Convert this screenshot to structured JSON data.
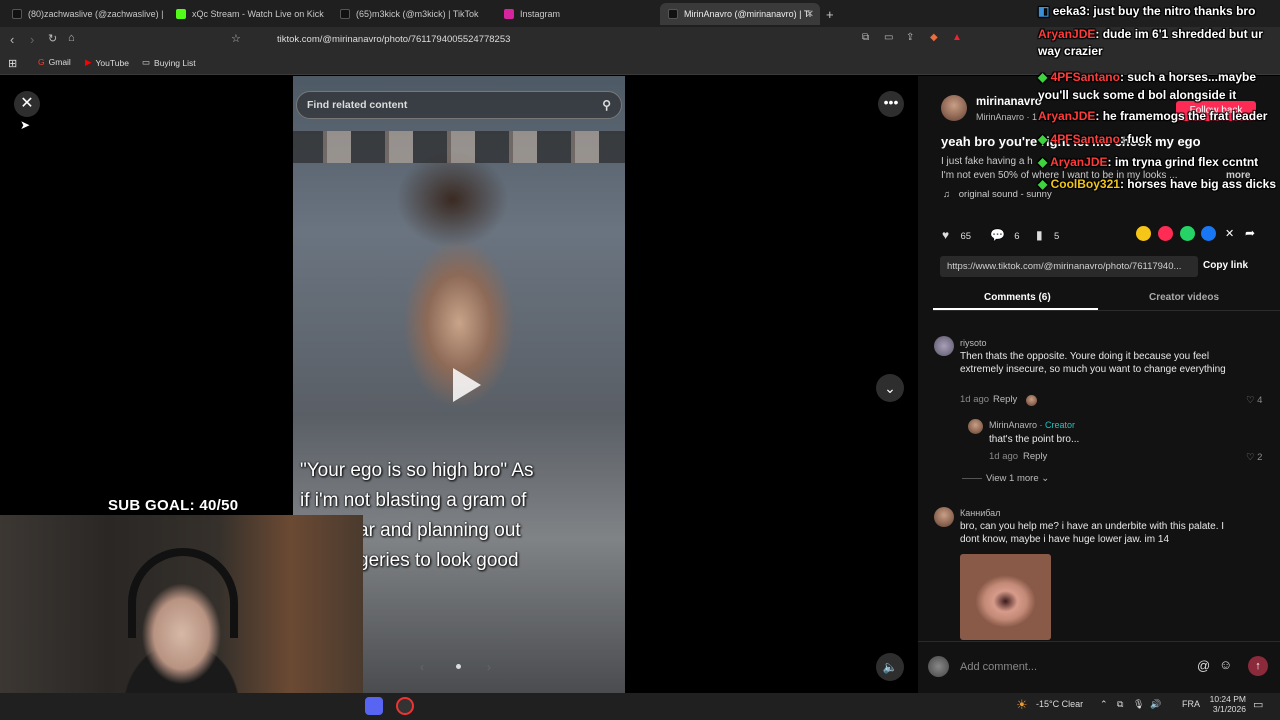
{
  "browser": {
    "tabs": [
      {
        "title": "(80)zachwaslive (@zachwaslive) | TikT",
        "color": "#111111"
      },
      {
        "title": "xQc Stream - Watch Live on Kick",
        "color": "#53fc18"
      },
      {
        "title": "(65)m3kick (@m3kick) | TikTok",
        "color": "#111111"
      },
      {
        "title": "Instagram",
        "color": "#d6249f"
      },
      {
        "title": "MirinAnavro (@mirinanavro) | Ti",
        "color": "#111111"
      }
    ],
    "url": "tiktok.com/@mirinanavro/photo/7611794005524778253",
    "bookmarks": [
      "Gmail",
      "YouTube",
      "Buying List"
    ]
  },
  "viewer": {
    "search_placeholder": "Find related content",
    "caption_lines": [
      "\"Your ego is so high bro\" As",
      "if i'm not blasting a gram of",
      "ar and planning out",
      "geries to look good"
    ]
  },
  "stream_overlay": {
    "sub_goal": "SUB GOAL: 40/50",
    "chat": [
      {
        "user": "eeka3",
        "text": ": just buy the nitro thanks bro",
        "color": "#ffffff"
      },
      {
        "user": "AryanJDE",
        "text": ": dude im 6'1 shredded but ur way crazier",
        "color": "#ff3b3b"
      },
      {
        "user": "4PFSantano",
        "text": ": such a horses...maybe you'll suck some d bol alongside it",
        "color": "#ff3b3b"
      },
      {
        "user": "AryanJDE",
        "text": ": he framemogs the frat leader",
        "color": "#ff3b3b"
      },
      {
        "user": "4PFSantano",
        "text": ": fuck",
        "color": "#ff3b3b"
      },
      {
        "user": "AryanJDE",
        "text": ": im tryna grind flex ccntnt",
        "color": "#ff3b3b"
      },
      {
        "user": "CoolBoy321",
        "text": ": horses have big ass dicks",
        "color": "#f0c419"
      }
    ]
  },
  "post": {
    "username": "mirinanavro",
    "display_name": "MirinAnavro · 1",
    "follow_label": "Follow back",
    "title": "yeah bro you're right let me check my ego",
    "body": "I just fake having a h",
    "body2": "I'm not even 50% of where I want to be in my looks ...",
    "more": "more",
    "sound": "original sound - sunny",
    "likes": "65",
    "comments": "6",
    "saves": "5",
    "link": "https://www.tiktok.com/@mirinanavro/photo/76117940...",
    "copy_link": "Copy link",
    "tab_comments": "Comments (6)",
    "tab_creator": "Creator videos"
  },
  "comments": [
    {
      "user": "riysoto",
      "text": "Then thats the opposite. Youre doing it because you feel extremely insecure, so much you want to change everything",
      "time": "1d ago",
      "reply": "Reply",
      "likes": "4"
    },
    {
      "user": "MirinAnavro",
      "badge": "Creator",
      "text": "that's the point bro...",
      "time": "1d ago",
      "reply": "Reply",
      "likes": "2"
    },
    {
      "user": "Каннибал",
      "text": "bro, can you help me? i have an underbite with this palate. I dont know, maybe i have huge lower jaw. im 14"
    }
  ],
  "view_more": "View 1 more",
  "add_comment_placeholder": "Add comment...",
  "taskbar": {
    "weather": "-15°C  Clear",
    "lang": "FRA",
    "time": "10:24 PM",
    "date": "3/1/2026"
  }
}
